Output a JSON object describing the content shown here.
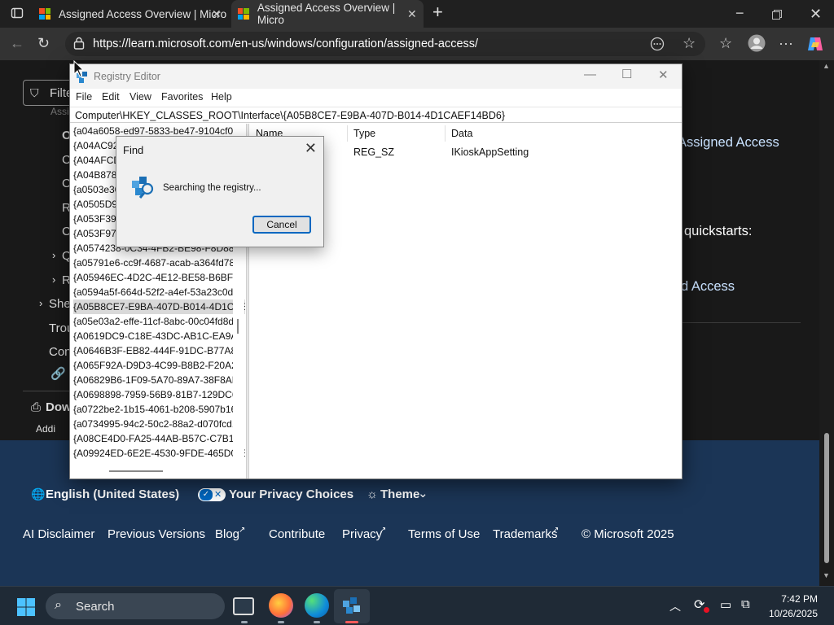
{
  "browser": {
    "tabs": [
      {
        "label": "Assigned Access Overview | Micro"
      },
      {
        "label": "Assigned Access Overview | Micro"
      }
    ],
    "url": "https://learn.microsoft.com/en-us/windows/configuration/assigned-access/"
  },
  "page": {
    "filter_label": "Filte",
    "nav_items": [
      "Assi",
      "O",
      "C",
      "C",
      "R",
      "C",
      "Q",
      "R",
      "Shel",
      "Trou",
      "Con",
      "Dow",
      "Addi"
    ],
    "article_fragments": [
      "Assigned Access",
      "quickstarts:",
      "d Access"
    ],
    "footer": {
      "language": "English (United States)",
      "privacy_choices": "Your Privacy Choices",
      "theme": "Theme",
      "links": [
        "AI Disclaimer",
        "Previous Versions",
        "Blog",
        "Contribute",
        "Privacy",
        "Terms of Use",
        "Trademarks",
        "© Microsoft 2025"
      ]
    }
  },
  "regedit": {
    "title": "Registry Editor",
    "menu": [
      "File",
      "Edit",
      "View",
      "Favorites",
      "Help"
    ],
    "path": "Computer\\HKEY_CLASSES_ROOT\\Interface\\{A05B8CE7-E9BA-407D-B014-4D1CAEF14BD6}",
    "tree_items": [
      "{a04a6058-ed97-5833-be47-9104cf0c",
      "{A04AC92",
      "{A04AFCD",
      "{A04B878A",
      "{a0503e30",
      "{A0505D9",
      "{A053F397",
      "{A053F97F",
      "{A0574238-0C34-4FB2-BE98-F8D88A",
      "{a05791e6-cc9f-4687-acab-a364fd785",
      "{A05946EC-4D2C-4E12-BE58-B6BF04",
      "{a0594a5f-664d-52f2-a4ef-53a23c0de",
      "{A05B8CE7-E9BA-407D-B014-4D1CAE",
      "{a05e03a2-effe-11cf-8abc-00c04fd8d",
      "{A0619DC9-C18E-43DC-AB1C-EA9AC",
      "{A0646B3F-EB82-444F-91DC-B77A82",
      "{A065F92A-D9D3-4C99-B8B2-F20A25",
      "{A06829B6-1F09-5A70-89A7-38F8AF7",
      "{A0698898-7959-56B9-81B7-129DC6E",
      "{a0722be2-1b15-4061-b208-5907b163",
      "{a0734995-94c2-50c2-88a2-d070fcd1",
      "{A08CE4D0-FA25-44AB-B57C-C7B1C",
      "{A09924ED-6E2E-4530-9FDE-465D02E"
    ],
    "columns": [
      "Name",
      "Type",
      "Data"
    ],
    "values": [
      {
        "type": "REG_SZ",
        "data": "IKioskAppSetting"
      }
    ]
  },
  "find_dialog": {
    "title": "Find",
    "message": "Searching the registry...",
    "cancel": "Cancel"
  },
  "taskbar": {
    "search": "Search",
    "time": "7:42 PM",
    "date": "10/26/2025"
  },
  "colors": {
    "accent": "#0067c0",
    "footer_bg": "#1b3556",
    "link_blue": "#c9e2ff",
    "taskbar_bg": "#1f2a36"
  }
}
